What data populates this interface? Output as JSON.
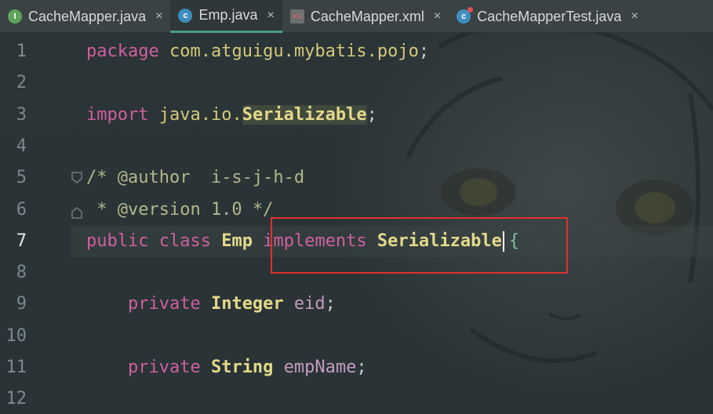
{
  "tabs": [
    {
      "label": "CacheMapper.java",
      "icon": "interface-icon",
      "icon_glyph": "I",
      "active": false
    },
    {
      "label": "Emp.java",
      "icon": "class-icon",
      "icon_glyph": "c",
      "active": true
    },
    {
      "label": "CacheMapper.xml",
      "icon": "xml-file-icon",
      "icon_glyph": "<>",
      "active": false
    },
    {
      "label": "CacheMapperTest.java",
      "icon": "test-class-icon",
      "icon_glyph": "c",
      "active": false
    }
  ],
  "close_glyph": "×",
  "editor": {
    "current_line": 7,
    "lines": [
      {
        "num": "1",
        "parts": [
          [
            "kw",
            "package"
          ],
          [
            "plain",
            " "
          ],
          [
            "pkg",
            "com.atguigu.mybatis.pojo"
          ],
          [
            "plain",
            ";"
          ]
        ]
      },
      {
        "num": "2",
        "parts": []
      },
      {
        "num": "3",
        "parts": [
          [
            "kw",
            "import"
          ],
          [
            "plain",
            " "
          ],
          [
            "pkg",
            "java.io."
          ],
          [
            "type-ser",
            "Serializable"
          ],
          [
            "plain",
            ";"
          ]
        ]
      },
      {
        "num": "4",
        "parts": []
      },
      {
        "num": "5",
        "parts": [
          [
            "cmt",
            "/* @author  i-s-j-h-d"
          ]
        ]
      },
      {
        "num": "6",
        "parts": [
          [
            "cmt",
            " * @version 1.0 */"
          ]
        ]
      },
      {
        "num": "7",
        "parts": [
          [
            "kw",
            "public"
          ],
          [
            "plain",
            " "
          ],
          [
            "kw",
            "class"
          ],
          [
            "plain",
            " "
          ],
          [
            "type",
            "Emp"
          ],
          [
            "plain",
            " "
          ],
          [
            "kw",
            "implements"
          ],
          [
            "plain",
            " "
          ],
          [
            "type",
            "Serializable"
          ],
          [
            "caret",
            ""
          ],
          [
            "brace",
            "{"
          ]
        ]
      },
      {
        "num": "8",
        "parts": []
      },
      {
        "num": "9",
        "parts": [
          [
            "plain",
            "    "
          ],
          [
            "kw",
            "private"
          ],
          [
            "plain",
            " "
          ],
          [
            "type",
            "Integer"
          ],
          [
            "plain",
            " "
          ],
          [
            "fld",
            "eid"
          ],
          [
            "plain",
            ";"
          ]
        ]
      },
      {
        "num": "10",
        "parts": []
      },
      {
        "num": "11",
        "parts": [
          [
            "plain",
            "    "
          ],
          [
            "kw",
            "private"
          ],
          [
            "plain",
            " "
          ],
          [
            "type",
            "String"
          ],
          [
            "plain",
            " "
          ],
          [
            "fld",
            "empName"
          ],
          [
            "plain",
            ";"
          ]
        ]
      },
      {
        "num": "12",
        "parts": []
      }
    ]
  },
  "colors": {
    "keyword": "#cf5fa0",
    "package": "#d3c97a",
    "type": "#e3d98a",
    "comment": "#b1b78a",
    "field": "#c59ac0",
    "highlight_box": "#e03030"
  }
}
